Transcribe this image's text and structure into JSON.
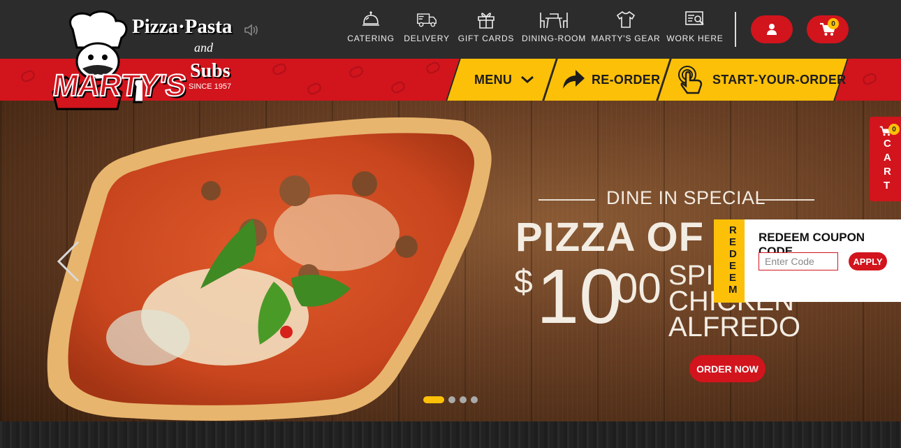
{
  "brand": {
    "line1": "Pizza·Pasta",
    "and": "and",
    "line2": "Subs",
    "name": "MARTY'S",
    "since": "SINCE 1957"
  },
  "top_nav": [
    {
      "label": "CATERING",
      "icon": "catering-icon"
    },
    {
      "label": "DELIVERY",
      "icon": "delivery-truck-icon"
    },
    {
      "label": "GIFT CARDS",
      "icon": "gift-icon"
    },
    {
      "label": "DINING-ROOM",
      "icon": "dining-table-icon"
    },
    {
      "label": "MARTY'S GEAR",
      "icon": "tshirt-icon"
    },
    {
      "label": "WORK HERE",
      "icon": "job-search-icon"
    }
  ],
  "header_actions": {
    "account_icon": "user-icon",
    "cart_icon": "cart-icon",
    "cart_count": "0"
  },
  "order_tabs": [
    {
      "label": "MENU",
      "icon": "chevron-down-icon"
    },
    {
      "label": "RE-ORDER",
      "icon": "reorder-arrow-icon"
    },
    {
      "label": "START-YOUR-ORDER",
      "icon": "touch-hand-icon"
    }
  ],
  "hero": {
    "kicker": "DINE IN SPECIAL",
    "headline": "PIZZA OF TI",
    "currency": "$",
    "price_whole": "10",
    "price_cents": "00",
    "item_line1": "SPIN",
    "item_line2": "CHICKEN",
    "item_line3": "ALFREDO",
    "cta": "ORDER NOW",
    "slides_total": 4,
    "active_slide": 1
  },
  "side_cart": {
    "label": "CART",
    "count": "0"
  },
  "coupon": {
    "tab_label": "REDEEM",
    "title": "REDEEM COUPON CODE",
    "placeholder": "Enter Code",
    "value": "",
    "apply_label": "APPLY"
  },
  "colors": {
    "brand_red": "#d2141d",
    "accent_yellow": "#fdc008",
    "header_dark": "#2c2c2c"
  }
}
